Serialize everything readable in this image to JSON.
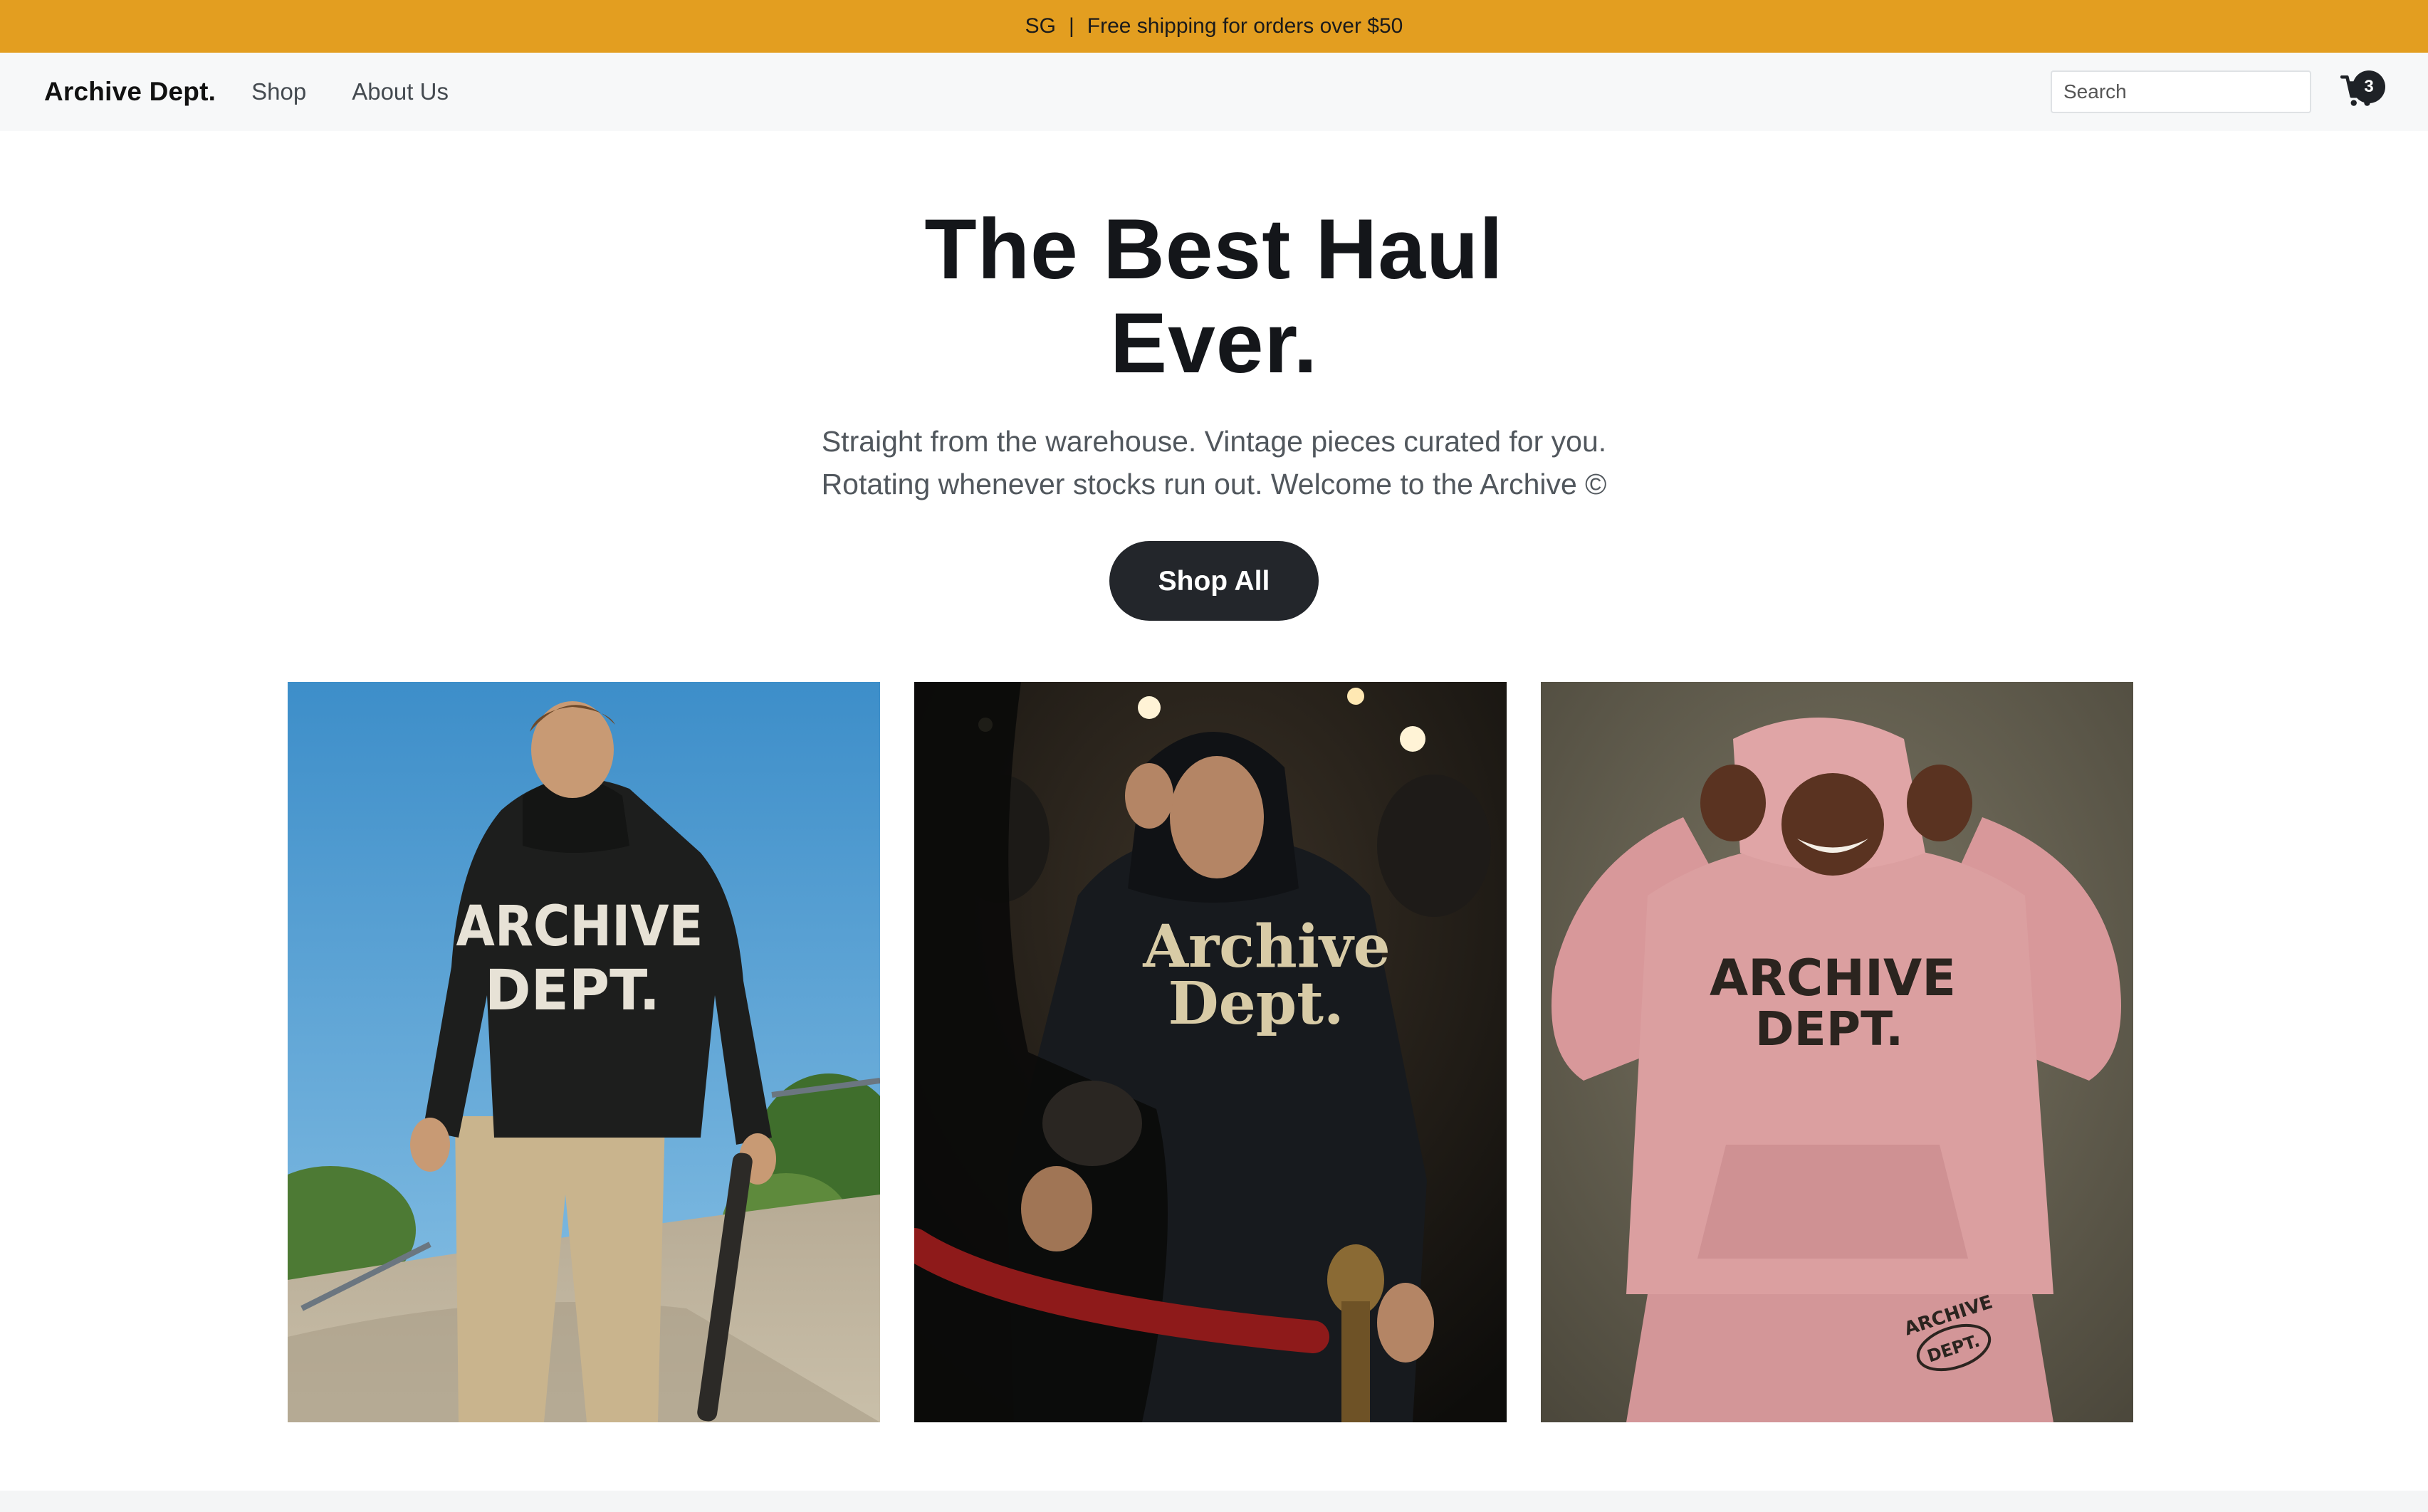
{
  "announcement": {
    "region": "SG",
    "separator": "|",
    "message": "Free shipping for orders over $50"
  },
  "nav": {
    "brand": "Archive Dept.",
    "links": [
      "Shop",
      "About Us"
    ],
    "search_placeholder": "Search",
    "cart_count": "3"
  },
  "hero": {
    "title_line1": "The Best Haul",
    "title_line2": "Ever.",
    "subtitle_line1": "Straight from the warehouse. Vintage pieces curated for you.",
    "subtitle_line2": "Rotating whenever stocks run out. Welcome to the Archive ©",
    "cta_label": "Shop All"
  },
  "gallery": [
    {
      "print_line1": "ARCHIVE",
      "print_line2": "DEPT."
    },
    {
      "print_line1": "Archive",
      "print_line2": "Dept."
    },
    {
      "print_line1": "ARCHIVE",
      "print_line2": "DEPT.",
      "pants_print_line1": "ARCHIVE",
      "pants_print_line2": "DEPT."
    }
  ],
  "colors": {
    "announcement_bg": "#e39e20",
    "navbar_bg": "#f7f8f9",
    "button_bg": "#23262b"
  }
}
